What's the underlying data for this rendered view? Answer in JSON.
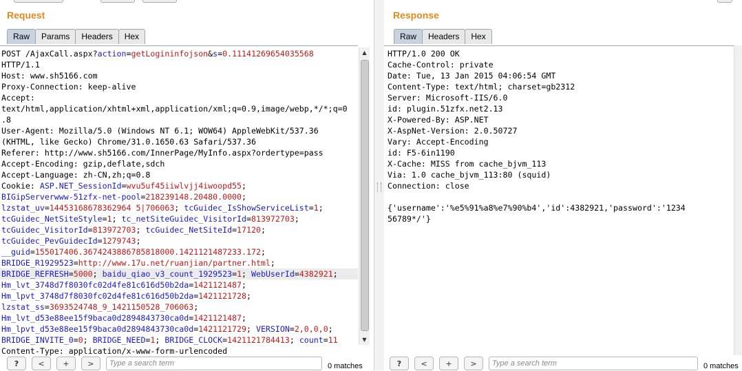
{
  "request": {
    "title": "Request",
    "tabs": [
      "Raw",
      "Params",
      "Headers",
      "Hex"
    ],
    "active_tab": "Raw",
    "lines": [
      [
        [
          "t",
          "POST /AjaxCall.aspx?"
        ],
        [
          "k",
          "action"
        ],
        [
          "t",
          "="
        ],
        [
          "v",
          "getLogininfojson"
        ],
        [
          "t",
          "&"
        ],
        [
          "k",
          "s"
        ],
        [
          "t",
          "="
        ],
        [
          "v",
          "0.11141269654035568"
        ]
      ],
      [
        [
          "t",
          "HTTP/1.1"
        ]
      ],
      [
        [
          "t",
          "Host: www.sh5166.com"
        ]
      ],
      [
        [
          "t",
          "Proxy-Connection: keep-alive"
        ]
      ],
      [
        [
          "t",
          "Accept:"
        ]
      ],
      [
        [
          "t",
          "text/html,application/xhtml+xml,application/xml;q=0.9,image/webp,*/*;q=0"
        ]
      ],
      [
        [
          "t",
          ".8"
        ]
      ],
      [
        [
          "t",
          "User-Agent: Mozilla/5.0 (Windows NT 6.1; WOW64) AppleWebKit/537.36"
        ]
      ],
      [
        [
          "t",
          "(KHTML, like Gecko) Chrome/31.0.1650.63 Safari/537.36"
        ]
      ],
      [
        [
          "t",
          "Referer: http://www.sh5166.com/InnerPage/MyInfo.aspx?ordertype=pass"
        ]
      ],
      [
        [
          "t",
          "Accept-Encoding: gzip,deflate,sdch"
        ]
      ],
      [
        [
          "t",
          "Accept-Language: zh-CN,zh;q=0.8"
        ]
      ],
      [
        [
          "t",
          "Cookie: "
        ],
        [
          "k",
          "ASP.NET_SessionId"
        ],
        [
          "t",
          "="
        ],
        [
          "v",
          "wvu5uf45iiwlvjj4iwoopd55"
        ],
        [
          "t",
          ";"
        ]
      ],
      [
        [
          "k",
          "BIGipServerwww-51zfx-net-pool"
        ],
        [
          "t",
          "="
        ],
        [
          "v",
          "218239148.20480.0000"
        ],
        [
          "t",
          ";"
        ]
      ],
      [
        [
          "k",
          "lzstat_uv"
        ],
        [
          "t",
          "="
        ],
        [
          "v",
          "14453168678362964 5|706063"
        ],
        [
          "t",
          "; "
        ],
        [
          "k",
          "tcGuidec_IsShowServiceList"
        ],
        [
          "t",
          "="
        ],
        [
          "v",
          "1"
        ],
        [
          "t",
          ";"
        ]
      ],
      [
        [
          "k",
          "tcGuidec_NetSiteStyle"
        ],
        [
          "t",
          "="
        ],
        [
          "v",
          "1"
        ],
        [
          "t",
          "; "
        ],
        [
          "k",
          "tc_netSiteGuidec_VisitorId"
        ],
        [
          "t",
          "="
        ],
        [
          "v",
          "813972703"
        ],
        [
          "t",
          ";"
        ]
      ],
      [
        [
          "k",
          "tcGuidec_VisitorId"
        ],
        [
          "t",
          "="
        ],
        [
          "v",
          "813972703"
        ],
        [
          "t",
          "; "
        ],
        [
          "k",
          "tcGuidec_NetSiteId"
        ],
        [
          "t",
          "="
        ],
        [
          "v",
          "17120"
        ],
        [
          "t",
          ";"
        ]
      ],
      [
        [
          "k",
          "tcGuidec_PevGuidecId"
        ],
        [
          "t",
          "="
        ],
        [
          "v",
          "1279743"
        ],
        [
          "t",
          ";"
        ]
      ],
      [
        [
          "k",
          "__guid"
        ],
        [
          "t",
          "="
        ],
        [
          "v",
          "155017406.3674243886785818000.1421121487233.172"
        ],
        [
          "t",
          ";"
        ]
      ],
      [
        [
          "k",
          "BRIDGE_R1929523"
        ],
        [
          "t",
          "="
        ],
        [
          "v",
          "http://www.17u.net/ruanjian/partner.html"
        ],
        [
          "t",
          ";"
        ]
      ],
      [
        [
          "k",
          "BRIDGE_REFRESH"
        ],
        [
          "t",
          "="
        ],
        [
          "v",
          "5000"
        ],
        [
          "t",
          "; "
        ],
        [
          "k",
          "baidu_qiao_v3_count_1929523"
        ],
        [
          "t",
          "="
        ],
        [
          "v",
          "1"
        ],
        [
          "t",
          "; "
        ],
        [
          "k",
          "WebUserId"
        ],
        [
          "t",
          "="
        ],
        [
          "v",
          "4382921"
        ],
        [
          "t",
          ";"
        ]
      ],
      [
        [
          "k",
          "Hm_lvt_3748d7f8030fc02d4fe81c616d50b2da"
        ],
        [
          "t",
          "="
        ],
        [
          "v",
          "1421121487"
        ],
        [
          "t",
          ";"
        ]
      ],
      [
        [
          "k",
          "Hm_lpvt_3748d7f8030fc02d4fe81c616d50b2da"
        ],
        [
          "t",
          "="
        ],
        [
          "v",
          "1421121728"
        ],
        [
          "t",
          ";"
        ]
      ],
      [
        [
          "k",
          "lzstat_ss"
        ],
        [
          "t",
          "="
        ],
        [
          "v",
          "3693524748_9_1421150528_706063"
        ],
        [
          "t",
          ";"
        ]
      ],
      [
        [
          "k",
          "Hm_lvt_d53e88ee15f9baca0d2894843730ca0d"
        ],
        [
          "t",
          "="
        ],
        [
          "v",
          "1421121487"
        ],
        [
          "t",
          ";"
        ]
      ],
      [
        [
          "k",
          "Hm_lpvt_d53e88ee15f9baca0d2894843730ca0d"
        ],
        [
          "t",
          "="
        ],
        [
          "v",
          "1421121729"
        ],
        [
          "t",
          "; "
        ],
        [
          "k",
          "VERSION"
        ],
        [
          "t",
          "="
        ],
        [
          "v",
          "2,0,0,0"
        ],
        [
          "t",
          ";"
        ]
      ],
      [
        [
          "k",
          "BRIDGE_INVITE_0"
        ],
        [
          "t",
          "="
        ],
        [
          "v",
          "0"
        ],
        [
          "t",
          "; "
        ],
        [
          "k",
          "BRIDGE_NEED"
        ],
        [
          "t",
          "="
        ],
        [
          "v",
          "1"
        ],
        [
          "t",
          "; "
        ],
        [
          "k",
          "BRIDGE_CLOCK"
        ],
        [
          "t",
          "="
        ],
        [
          "v",
          "1421121784413"
        ],
        [
          "t",
          "; "
        ],
        [
          "k",
          "count"
        ],
        [
          "t",
          "="
        ],
        [
          "v",
          "11"
        ]
      ],
      [
        [
          "t",
          "Content-Type: application/x-www-form-urlencoded"
        ]
      ]
    ],
    "highlighted_line": 20,
    "search": {
      "placeholder": "Type a search term",
      "matches": "0 matches"
    },
    "buttons": [
      "?",
      "<",
      "+",
      ">"
    ]
  },
  "response": {
    "title": "Response",
    "tabs": [
      "Raw",
      "Headers",
      "Hex"
    ],
    "active_tab": "Raw",
    "lines": [
      "HTTP/1.0 200 OK",
      "Cache-Control: private",
      "Date: Tue, 13 Jan 2015 04:06:54 GMT",
      "Content-Type: text/html; charset=gb2312",
      "Server: Microsoft-IIS/6.0",
      "id: plugin.51zfx.net2.13",
      "X-Powered-By: ASP.NET",
      "X-AspNet-Version: 2.0.50727",
      "Vary: Accept-Encoding",
      "id: F5-6in1190",
      "X-Cache: MISS from cache_bjvm_113",
      "Via: 1.0 cache_bjvm_113:80 (squid)",
      "Connection: close",
      "",
      "{'username':'%e5%91%a8%e7%90%b4','id':4382921,'password':'1234",
      "56789*/'}"
    ],
    "search": {
      "placeholder": "Type a search term",
      "matches": "0 matches"
    },
    "buttons": [
      "?",
      "<",
      "+",
      ">"
    ]
  }
}
